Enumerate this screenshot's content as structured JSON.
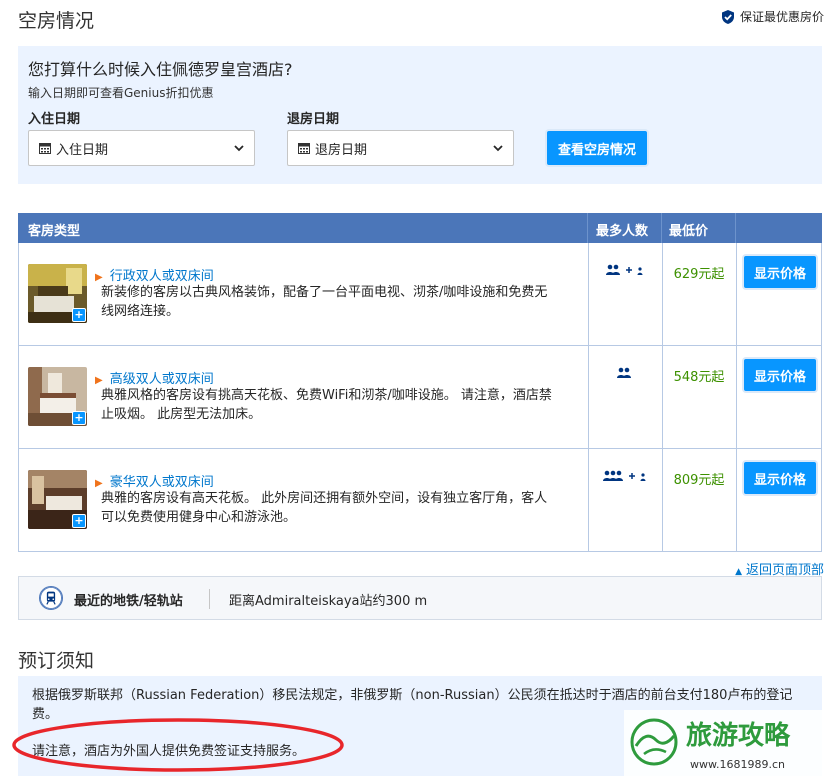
{
  "header": {
    "title": "空房情况",
    "guarantee": "保证最优惠房价",
    "guarantee_icon": "shield-check-icon"
  },
  "search": {
    "question": "您打算什么时候入住佩德罗皇宫酒店?",
    "subtitle": "输入日期即可查看Genius折扣优惠",
    "checkin_label": "入住日期",
    "checkin_value": "入住日期",
    "checkout_label": "退房日期",
    "checkout_value": "退房日期",
    "button": "查看空房情况"
  },
  "table": {
    "headers": [
      "客房类型",
      "最多人数",
      "最低价"
    ],
    "rooms": [
      {
        "name": "行政双人或双床间",
        "desc_line1": "新装修的客房以古典风格装饰，配备了一台平面电视、沏茶/咖啡设施和免费无",
        "desc_line2": "线网络连接。",
        "occupancy": "2 adults + 1 child",
        "price": "629元起",
        "button": "显示价格"
      },
      {
        "name": "高级双人或双床间",
        "desc_line1": "典雅风格的客房设有挑高天花板、免费WiFi和沏茶/咖啡设施。 请注意，酒店禁",
        "desc_line2": "止吸烟。 此房型无法加床。",
        "occupancy": "2 adults",
        "price": "548元起",
        "button": "显示价格"
      },
      {
        "name": "豪华双人或双床间",
        "desc_line1": "典雅的客房设有高天花板。 此外房间还拥有额外空间，设有独立客厅角，客人",
        "desc_line2": "可以免费使用健身中心和游泳池。",
        "occupancy": "3 adults + 1 child",
        "price": "809元起",
        "button": "显示价格"
      }
    ],
    "back_to_top": "返回页面顶部"
  },
  "transit": {
    "label": "最近的地铁/轻轨站",
    "value": "距离Admiralteiskaya站约300 m"
  },
  "notice": {
    "title": "预订须知",
    "text1": "根据俄罗斯联邦（Russian Federation）移民法规定，非俄罗斯（non-Russian）公民须在抵达时于酒店的前台支付180卢布的登记费。",
    "text2": "请注意，酒店为外国人提供免费签证支持服务。"
  },
  "watermark": {
    "text": "旅游攻略",
    "url": "www.1681989.cn"
  },
  "colors": {
    "accent": "#0896ff",
    "header_bg": "#4b76b9",
    "link": "#0077cc",
    "price": "#3d9100",
    "panel": "#ebf3ff",
    "annotation": "#e8262b"
  }
}
